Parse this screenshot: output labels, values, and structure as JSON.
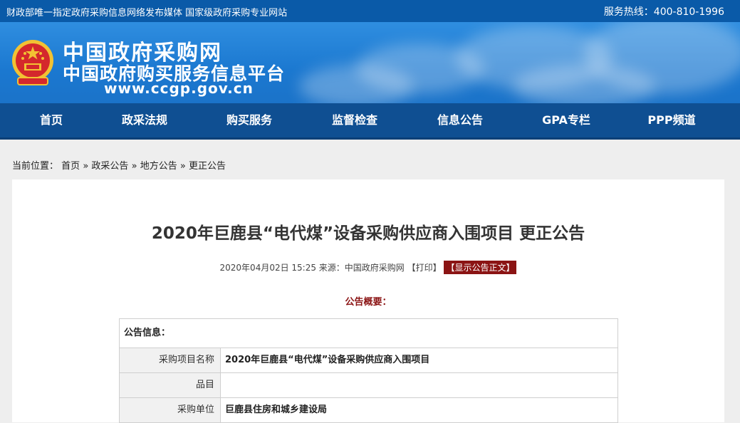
{
  "topbar": {
    "left_text": "财政部唯一指定政府采购信息网络发布媒体 国家级政府采购专业网站",
    "hotline": "服务热线：400-810-1996"
  },
  "banner": {
    "site_name": "中国政府采购网",
    "site_subtitle": "中国政府购买服务信息平台",
    "site_url": "www.ccgp.gov.cn"
  },
  "nav": {
    "items": [
      "首页",
      "政采法规",
      "购买服务",
      "监督检查",
      "信息公告",
      "GPA专栏",
      "PPP频道"
    ]
  },
  "breadcrumb": {
    "prefix": "当前位置：",
    "items": [
      "首页",
      "政采公告",
      "地方公告",
      "更正公告"
    ],
    "separator": "»"
  },
  "article": {
    "title": "2020年巨鹿县“电代煤”设备采购供应商入围项目 更正公告",
    "meta_text": "2020年04月02日 15:25 来源：中国政府采购网 ",
    "print_label": "【打印】",
    "show_body_label": "【显示公告正文】",
    "summary_heading": "公告概要："
  },
  "info_table": {
    "heading": "公告信息：",
    "rows": [
      {
        "label": "采购项目名称",
        "value": "2020年巨鹿县“电代煤”设备采购供应商入围项目"
      },
      {
        "label": "品目",
        "value": ""
      },
      {
        "label": "采购单位",
        "value": "巨鹿县住房和城乡建设局"
      }
    ]
  },
  "colors": {
    "topbar_bg": "#0a5aa8",
    "nav_bg": "#0f4f92",
    "accent_red": "#8b1414"
  }
}
